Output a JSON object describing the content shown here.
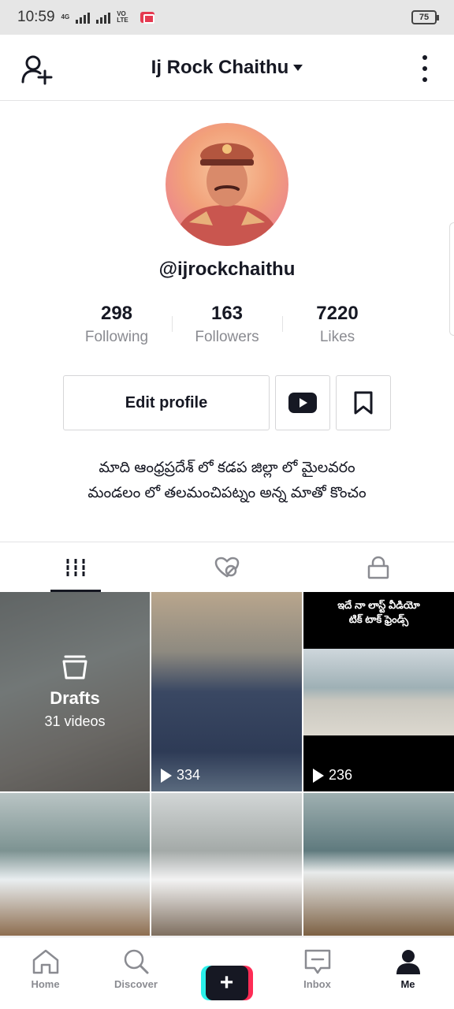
{
  "status_bar": {
    "time": "10:59",
    "network": "4G",
    "volte": "VO LTE",
    "battery": "75"
  },
  "header": {
    "title": "Ij Rock Chaithu"
  },
  "profile": {
    "username": "@ijrockchaithu",
    "stats": [
      {
        "value": "298",
        "label": "Following"
      },
      {
        "value": "163",
        "label": "Followers"
      },
      {
        "value": "7220",
        "label": "Likes"
      }
    ],
    "edit_label": "Edit profile",
    "bio_line1": "మాది ఆంధ్రప్రదేశ్ లో కడప జిల్లా లో మైలవరం",
    "bio_line2": "మండలం లో తలమంచిపట్నం అన్న మాతో కొంచం"
  },
  "grid": {
    "drafts": {
      "title": "Drafts",
      "count": "31 videos"
    },
    "videos": [
      {
        "views": "334"
      },
      {
        "views": "236",
        "caption_line1": "ఇదే నా లాస్ట్ వీడియో",
        "caption_line2": "టిక్ టాక్ ఫ్రెండ్స్"
      }
    ]
  },
  "bottom_nav": {
    "items": [
      {
        "label": "Home",
        "icon": "home-icon"
      },
      {
        "label": "Discover",
        "icon": "search-icon"
      },
      {
        "label": "",
        "icon": "create-icon"
      },
      {
        "label": "Inbox",
        "icon": "inbox-icon"
      },
      {
        "label": "Me",
        "icon": "profile-icon"
      }
    ],
    "active": "Me"
  }
}
